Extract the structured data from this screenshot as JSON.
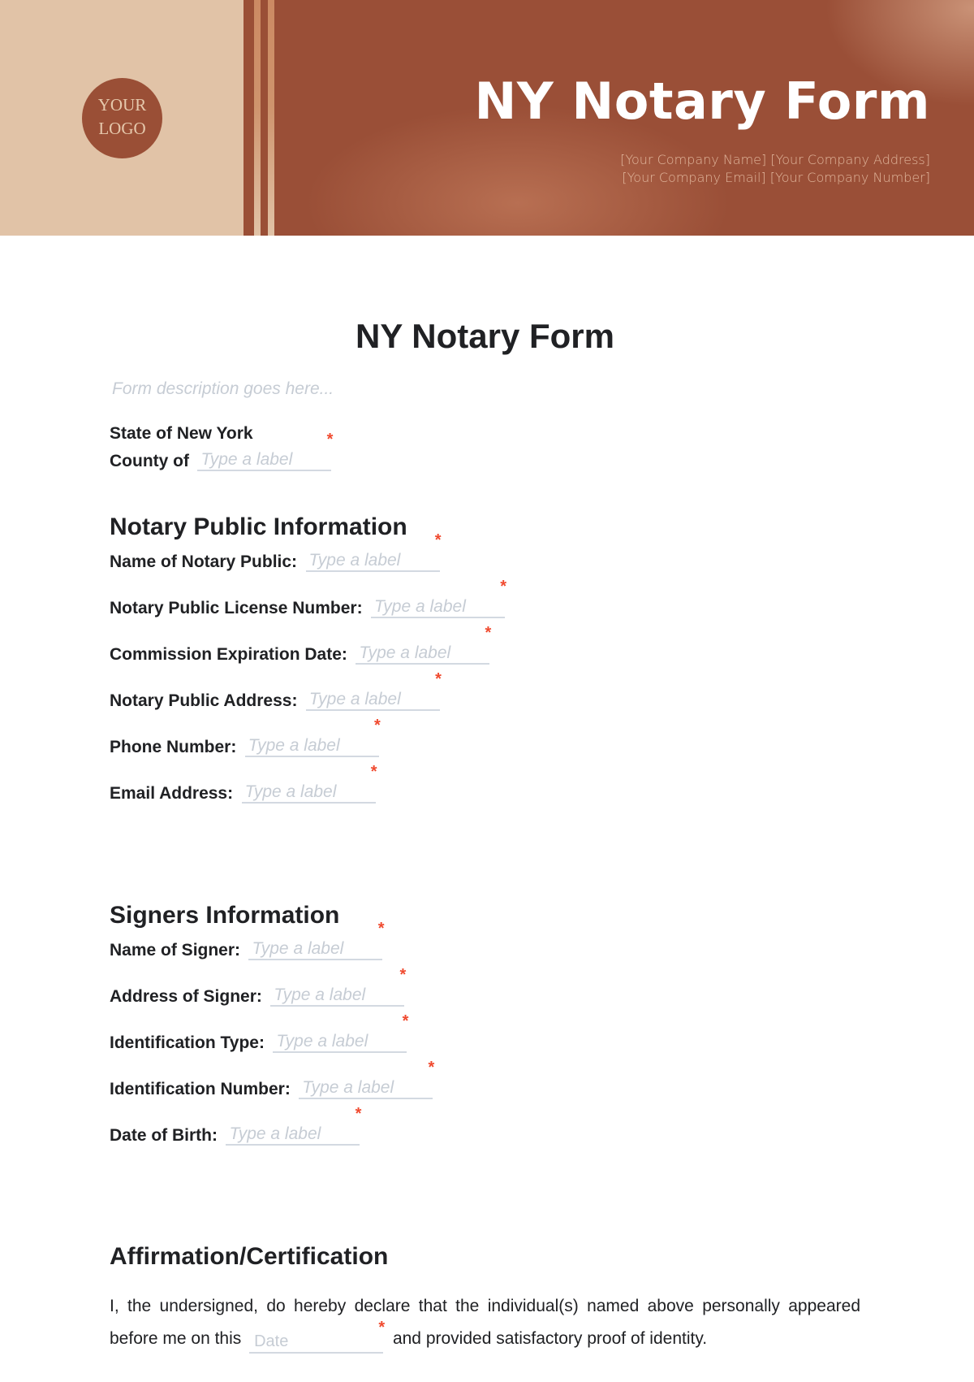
{
  "header": {
    "logo_line1": "YOUR",
    "logo_line2": "LOGO",
    "title": "NY Notary Form",
    "company_line1": "[Your Company Name] [Your Company Address]",
    "company_line2": "[Your Company Email] [Your Company Number]"
  },
  "colors": {
    "brand_dark": "#9a4f36",
    "brand_light": "#e1c3a7",
    "required_asterisk": "#f04a2f",
    "placeholder": "#c6ccd4"
  },
  "form": {
    "title": "NY Notary Form",
    "description_placeholder": "Form description goes here...",
    "state_line": "State of New York",
    "county": {
      "label": "County of",
      "placeholder": "Type a label",
      "required": true
    }
  },
  "sections": [
    {
      "title": "Notary Public Information",
      "fields": [
        {
          "label": "Name of Notary Public:",
          "placeholder": "Type a label",
          "required": true
        },
        {
          "label": "Notary Public License Number:",
          "placeholder": "Type a label",
          "required": true
        },
        {
          "label": "Commission Expiration Date:",
          "placeholder": "Type a label",
          "required": true
        },
        {
          "label": "Notary Public Address:",
          "placeholder": "Type a label",
          "required": true
        },
        {
          "label": "Phone Number:",
          "placeholder": "Type a label",
          "required": true
        },
        {
          "label": "Email Address:",
          "placeholder": "Type a label",
          "required": true
        }
      ]
    },
    {
      "title": "Signers Information",
      "fields": [
        {
          "label": "Name of Signer:",
          "placeholder": "Type a label",
          "required": true
        },
        {
          "label": "Address of Signer:",
          "placeholder": "Type a label",
          "required": true
        },
        {
          "label": "Identification Type:",
          "placeholder": "Type a label",
          "required": true
        },
        {
          "label": "Identification Number:",
          "placeholder": "Type a label",
          "required": true
        },
        {
          "label": "Date of Birth:",
          "placeholder": "Type a label",
          "required": true
        }
      ]
    },
    {
      "title": "Affirmation/Certification",
      "paragraph_before": "I, the undersigned, do hereby declare that the individual(s) named above personally appeared before me on this",
      "date_placeholder": "Date",
      "paragraph_after": "and provided satisfactory proof of identity."
    }
  ],
  "required_mark": "*"
}
